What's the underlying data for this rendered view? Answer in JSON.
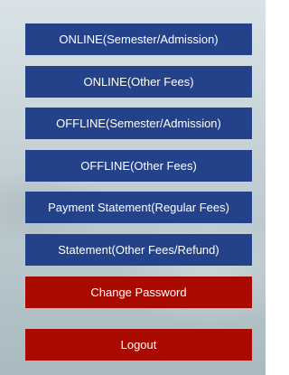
{
  "menu": {
    "online_semester": "ONLINE(Semester/Admission)",
    "online_other": "ONLINE(Other Fees)",
    "offline_semester": "OFFLINE(Semester/Admission)",
    "offline_other": "OFFLINE(Other Fees)",
    "payment_statement": "Payment Statement(Regular Fees)",
    "statement_other": "Statement(Other Fees/Refund)",
    "change_password": "Change Password",
    "logout": "Logout"
  },
  "colors": {
    "primary_button": "#23428a",
    "danger_button": "#a80a00",
    "button_text": "#ffffff"
  }
}
